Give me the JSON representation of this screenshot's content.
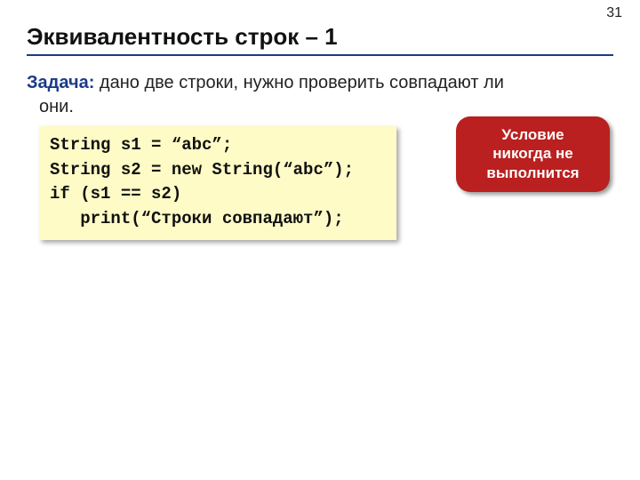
{
  "page_number": "31",
  "title": "Эквивалентность строк – 1",
  "task": {
    "label": "Задача:",
    "text_first_line": " дано две строки, нужно проверить совпадают ли",
    "text_second_line": "они."
  },
  "code": {
    "line1": "String s1 = “abc”;",
    "line2": "String s2 = new String(“abc”);",
    "line3": "if (s1 == s2)",
    "line4": "   print(“Строки совпадают”);"
  },
  "callout": {
    "line1": "Условие",
    "line2": "никогда не",
    "line3": "выполнится"
  }
}
